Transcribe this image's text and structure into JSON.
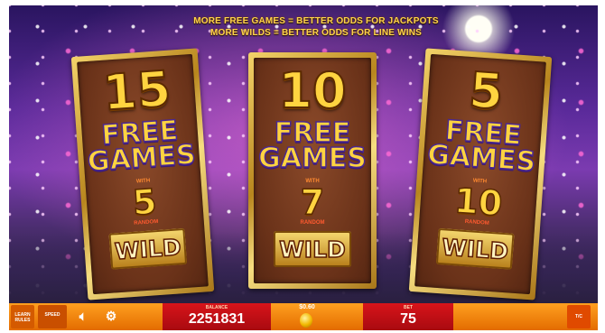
{
  "banner": {
    "line1": "MORE FREE GAMES = BETTER ODDS FOR JACKPOTS",
    "line2": "MORE WILDS = BETTER ODDS FOR LINE WINS"
  },
  "cards": [
    {
      "games": "15",
      "free": "FREE",
      "games_label": "GAMES",
      "with": "WITH",
      "wilds": "5",
      "random": "RANDOM",
      "wild": "WILD"
    },
    {
      "games": "10",
      "free": "FREE",
      "games_label": "GAMES",
      "with": "WITH",
      "wilds": "7",
      "random": "RANDOM",
      "wild": "WILD"
    },
    {
      "games": "5",
      "free": "FREE",
      "games_label": "GAMES",
      "with": "WITH",
      "wilds": "10",
      "random": "RANDOM",
      "wild": "WILD"
    }
  ],
  "bottom_bar": {
    "learn_label": "LEARN RULES",
    "speed_label": "SPEED",
    "sound_icon": "speaker-icon",
    "gamble_icon": "gamble-icon",
    "balance_label": "BALANCE",
    "balance_value": "2251831",
    "coin_value": "$0.60",
    "bet_label": "BET",
    "bet_value": "75",
    "tc_label": "T/C"
  },
  "colors": {
    "accent_gold": "#ffd440",
    "bar_orange": "#ff9a1a",
    "panel_red": "#d8141a"
  }
}
